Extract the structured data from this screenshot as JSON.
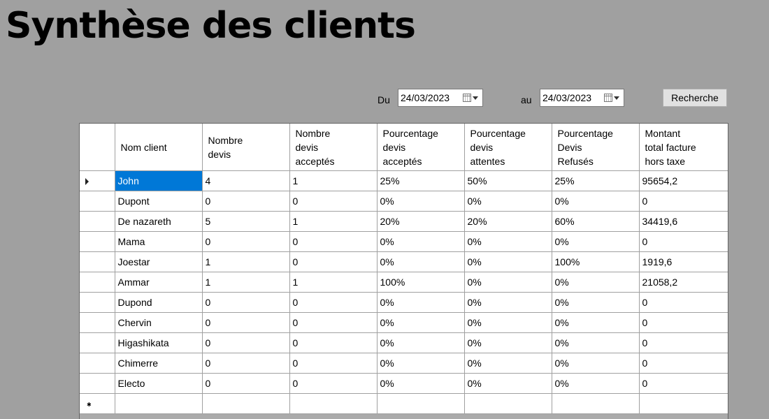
{
  "title": "Synthèse des clients",
  "filters": {
    "du_label": "Du",
    "date_from": "24/03/2023",
    "au_label": "au",
    "date_to": "24/03/2023",
    "search_label": "Recherche"
  },
  "grid": {
    "columns": [
      [
        "Nom client"
      ],
      [
        "Nombre",
        "devis"
      ],
      [
        "Nombre",
        "devis",
        "acceptés"
      ],
      [
        "Pourcentage",
        "devis",
        "acceptés"
      ],
      [
        "Pourcentage",
        "devis",
        "attentes"
      ],
      [
        "Pourcentage",
        "Devis",
        "Refusés"
      ],
      [
        "Montant",
        "total facture",
        "hors taxe"
      ]
    ],
    "rows": [
      [
        "John",
        "4",
        "1",
        "25%",
        "50%",
        "25%",
        "95654,2"
      ],
      [
        "Dupont",
        "0",
        "0",
        "0%",
        "0%",
        "0%",
        "0"
      ],
      [
        "De nazareth",
        "5",
        "1",
        "20%",
        "20%",
        "60%",
        "34419,6"
      ],
      [
        "Mama",
        "0",
        "0",
        "0%",
        "0%",
        "0%",
        "0"
      ],
      [
        "Joestar",
        "1",
        "0",
        "0%",
        "0%",
        "100%",
        "1919,6"
      ],
      [
        "Ammar",
        "1",
        "1",
        "100%",
        "0%",
        "0%",
        "21058,2"
      ],
      [
        "Dupond",
        "0",
        "0",
        "0%",
        "0%",
        "0%",
        "0"
      ],
      [
        "Chervin",
        "0",
        "0",
        "0%",
        "0%",
        "0%",
        "0"
      ],
      [
        "Higashikata",
        "0",
        "0",
        "0%",
        "0%",
        "0%",
        "0"
      ],
      [
        "Chimerre",
        "0",
        "0",
        "0%",
        "0%",
        "0%",
        "0"
      ],
      [
        "Electo",
        "0",
        "0",
        "0%",
        "0%",
        "0%",
        "0"
      ]
    ],
    "selected_row": 0,
    "new_row_marker": "✱"
  },
  "colors": {
    "background": "#a0a0a0",
    "selection": "#0078d7",
    "cell_bg": "#ffffff"
  }
}
